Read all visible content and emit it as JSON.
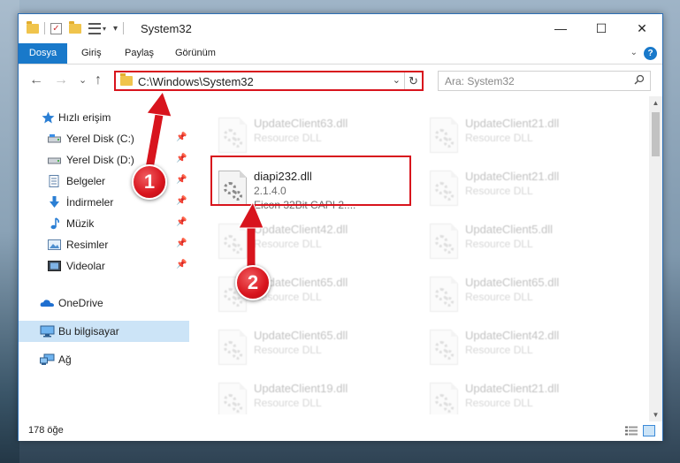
{
  "window": {
    "title": "System32",
    "minimize": "—",
    "maximize": "☐",
    "close": "✕"
  },
  "quick_access_toolbar": {
    "check_glyph": "✓",
    "arrow_glyph": "▾"
  },
  "ribbon": {
    "tabs": [
      "Dosya",
      "Giriş",
      "Paylaş",
      "Görünüm"
    ],
    "collapse_glyph": "⌄",
    "help_glyph": "?"
  },
  "navigation": {
    "back": "←",
    "forward": "→",
    "recent": "⌄",
    "up": "↑",
    "address": "C:\\Windows\\System32",
    "address_dropdown": "⌄",
    "refresh": "↻",
    "search_placeholder": "Ara: System32"
  },
  "sidebar": {
    "pin_glyph": "📌",
    "items": [
      {
        "label": "Hızlı erişim",
        "icon": "star-icon",
        "pinned": false
      },
      {
        "label": "Yerel Disk (C:)",
        "icon": "drive-icon",
        "pinned": true
      },
      {
        "label": "Yerel Disk (D:)",
        "icon": "drive-icon",
        "pinned": true
      },
      {
        "label": "Belgeler",
        "icon": "documents-icon",
        "pinned": true
      },
      {
        "label": "İndirmeler",
        "icon": "download-icon",
        "pinned": true
      },
      {
        "label": "Müzik",
        "icon": "music-icon",
        "pinned": true
      },
      {
        "label": "Resimler",
        "icon": "pictures-icon",
        "pinned": true
      },
      {
        "label": "Videolar",
        "icon": "videos-icon",
        "pinned": true
      },
      {
        "label": "OneDrive",
        "icon": "cloud-icon",
        "pinned": false
      },
      {
        "label": "Bu bilgisayar",
        "icon": "computer-icon",
        "pinned": false,
        "selected": true
      },
      {
        "label": "Ağ",
        "icon": "network-icon",
        "pinned": false
      }
    ]
  },
  "files": [
    {
      "name": "UpdateClient63.dll",
      "line2": "Resource DLL",
      "line3": "",
      "dim": true
    },
    {
      "name": "UpdateClient21.dll",
      "line2": "Resource DLL",
      "line3": "",
      "dim": true
    },
    {
      "name": "diapi232.dll",
      "line2": "2.1.4.0",
      "line3": "Eicon 32Bit CAPI 2....",
      "dim": false
    },
    {
      "name": "UpdateClient21.dll",
      "line2": "Resource DLL",
      "line3": "",
      "dim": true
    },
    {
      "name": "UpdateClient42.dll",
      "line2": "Resource DLL",
      "line3": "",
      "dim": true
    },
    {
      "name": "UpdateClient5.dll",
      "line2": "Resource DLL",
      "line3": "",
      "dim": true
    },
    {
      "name": "UpdateClient65.dll",
      "line2": "Resource DLL",
      "line3": "",
      "dim": true
    },
    {
      "name": "UpdateClient65.dll",
      "line2": "Resource DLL",
      "line3": "",
      "dim": true
    },
    {
      "name": "UpdateClient65.dll",
      "line2": "Resource DLL",
      "line3": "",
      "dim": true
    },
    {
      "name": "UpdateClient42.dll",
      "line2": "Resource DLL",
      "line3": "",
      "dim": true
    },
    {
      "name": "UpdateClient19.dll",
      "line2": "Resource DLL",
      "line3": "",
      "dim": true
    },
    {
      "name": "UpdateClient21.dll",
      "line2": "Resource DLL",
      "line3": "",
      "dim": true
    }
  ],
  "status": {
    "item_count": "178 öğe"
  },
  "annotations": {
    "badge1": "1",
    "badge2": "2",
    "color": "#d8141d"
  }
}
